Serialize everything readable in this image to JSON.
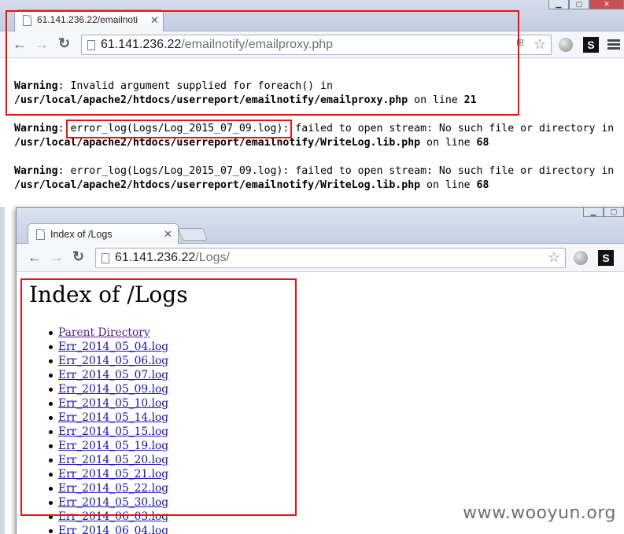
{
  "back_window": {
    "tab_title": "61.141.236.22/emailnoti",
    "url_host": "61.141.236.22",
    "url_path": "/emailnotify/emailproxy.php",
    "extension_label": "S",
    "php_output": [
      {
        "label": "Warning",
        "message": ": Invalid argument supplied for foreach() in",
        "file": "/usr/local/apache2/htdocs/userreport/emailnotify/emailproxy.php",
        "on_line_text": " on line ",
        "line": "21"
      },
      {
        "label": "Warning",
        "colon": ": ",
        "call": "error_log(Logs/Log_2015_07_09.log)",
        "message": ": failed to open stream: No such file or directory in",
        "file": "/usr/local/apache2/htdocs/userreport/emailnotify/WriteLog.lib.php",
        "on_line_text": " on line ",
        "line": "68"
      },
      {
        "label": "Warning",
        "message": ": error_log(Logs/Log_2015_07_09.log): failed to open stream: No such file or directory in",
        "file": "/usr/local/apache2/htdocs/userreport/emailnotify/WriteLog.lib.php",
        "on_line_text": " on line ",
        "line": "68"
      }
    ]
  },
  "front_window": {
    "tab_title": "Index of /Logs",
    "url_host": "61.141.236.22",
    "url_path": "/Logs/",
    "extension_label": "S",
    "page_title": "Index of /Logs",
    "links": [
      "Parent Directory",
      "Err_2014_05_04.log",
      "Err_2014_05_06.log",
      "Err_2014_05_07.log",
      "Err_2014_05_09.log",
      "Err_2014_05_10.log",
      "Err_2014_05_14.log",
      "Err_2014_05_15.log",
      "Err_2014_05_19.log",
      "Err_2014_05_20.log",
      "Err_2014_05_21.log",
      "Err_2014_05_22.log",
      "Err_2014_05_30.log",
      "Err_2014_06_03.log",
      "Err_2014_06_04.log"
    ]
  },
  "watermark": "www.wooyun.org",
  "colors": {
    "annotation": "#ee1111",
    "link": "#1a0dab",
    "visited_link": "#551a8b"
  }
}
